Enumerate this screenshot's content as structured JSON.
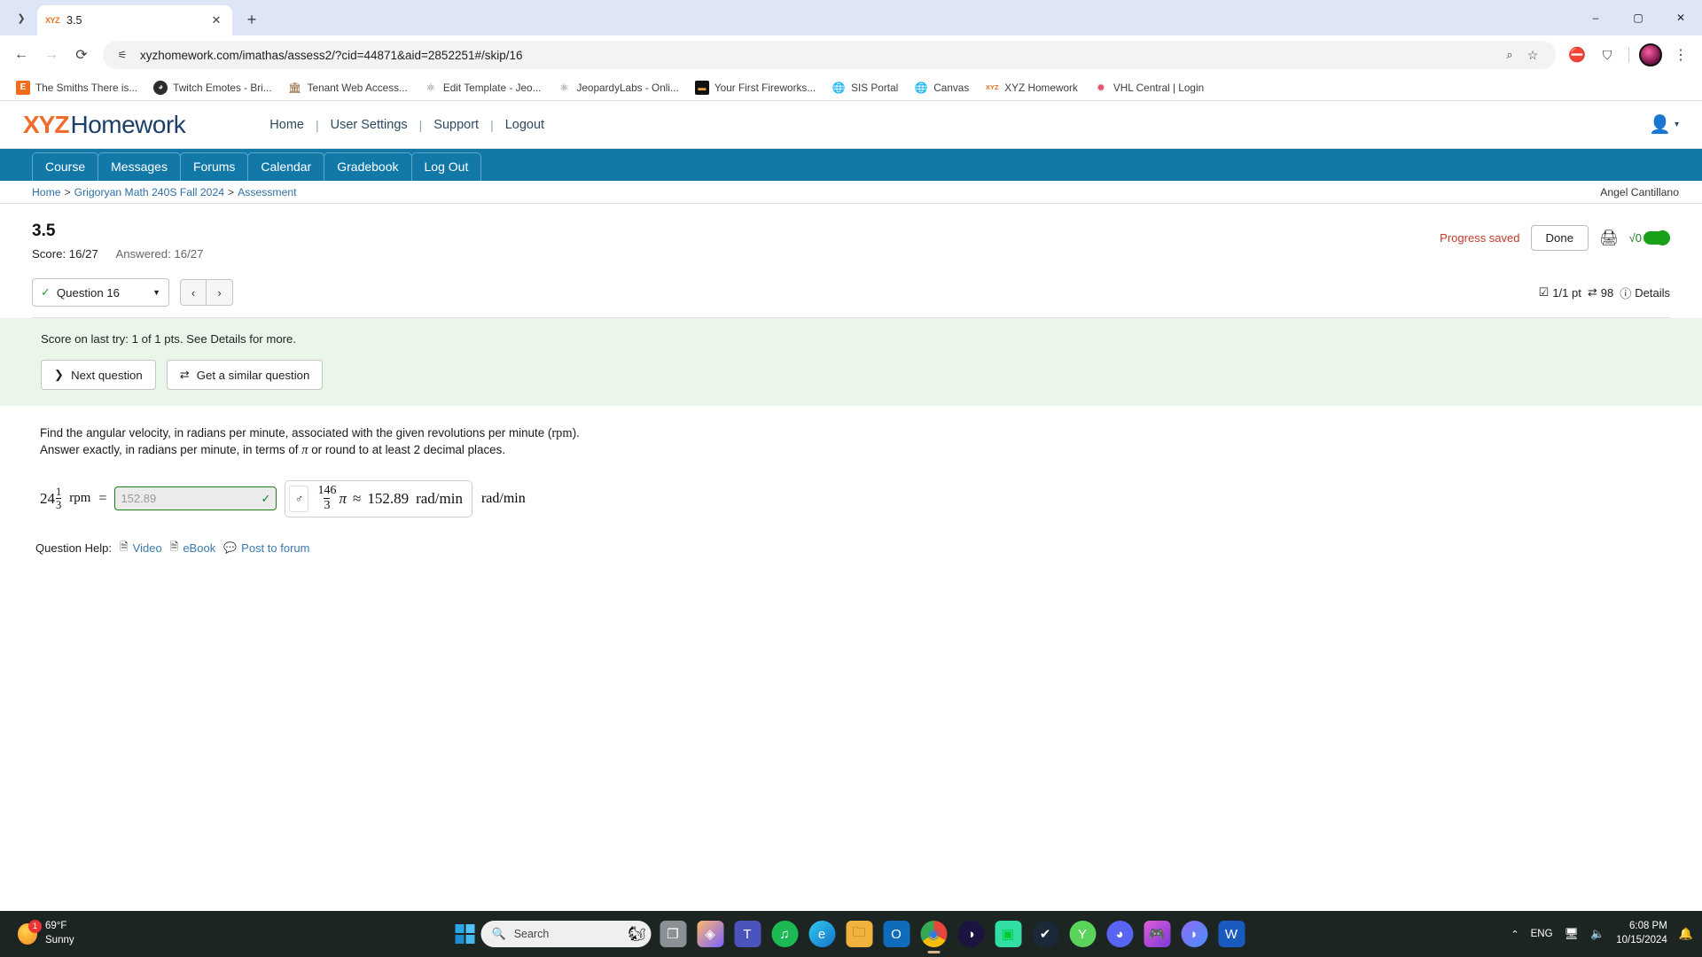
{
  "browser": {
    "tab": {
      "title": "3.5",
      "favicon": "XYZ",
      "close_icon": "close-icon"
    },
    "new_tab_label": "+",
    "window_controls": {
      "minimize": "–",
      "maximize": "▢",
      "close": "✕"
    },
    "nav": {
      "back": "←",
      "forward": "→",
      "reload": "⟳"
    },
    "omnibox": {
      "url": "xyzhomework.com/imathas/assess2/?cid=44871&aid=2852251#/skip/16",
      "site_settings_icon": "site-settings-icon",
      "zoom_icon": "zoom-out-icon",
      "bookmark_icon": "star-icon"
    },
    "extensions": {
      "adblock": "adblock-icon",
      "puzzle": "extensions-icon",
      "profile": "profile-avatar",
      "menu": "⋮"
    },
    "bookmarks": [
      {
        "label": "The Smiths There is...",
        "icon": "E",
        "icon_type": "letter-orange"
      },
      {
        "label": "Twitch Emotes - Bri...",
        "icon": "◕",
        "icon_type": "face"
      },
      {
        "label": "Tenant Web Access...",
        "icon": "🏛",
        "icon_type": "building"
      },
      {
        "label": "Edit Template - Jeo...",
        "icon": "⚛",
        "icon_type": "atom"
      },
      {
        "label": "JeopardyLabs - Onli...",
        "icon": "⚛",
        "icon_type": "atom"
      },
      {
        "label": "Your First Fireworks...",
        "icon": "▬",
        "icon_type": "black"
      },
      {
        "label": "SIS Portal",
        "icon": "🌐",
        "icon_type": "globe"
      },
      {
        "label": "Canvas",
        "icon": "🌐",
        "icon_type": "globe"
      },
      {
        "label": "XYZ Homework",
        "icon": "XYZ",
        "icon_type": "xyz"
      },
      {
        "label": "VHL Central | Login",
        "icon": "✹",
        "icon_type": "vhl"
      }
    ]
  },
  "site": {
    "logo": {
      "xyz": "XYZ",
      "homework": "Homework"
    },
    "header_links": [
      "Home",
      "User Settings",
      "Support",
      "Logout"
    ],
    "header_separator": "|",
    "user_icon": "user-avatar-icon",
    "user_caret": "▾",
    "nav_tabs": [
      "Course",
      "Messages",
      "Forums",
      "Calendar",
      "Gradebook",
      "Log Out"
    ],
    "breadcrumb": {
      "items": [
        "Home",
        "Grigoryan Math 240S Fall 2024",
        "Assessment"
      ],
      "separator": ">"
    },
    "user_name": "Angel Cantillano"
  },
  "assessment": {
    "title": "3.5",
    "score_label": "Score: 16/27",
    "answered_label": "Answered: 16/27",
    "progress_saved": "Progress saved",
    "done_button": "Done",
    "print_icon": "print-icon",
    "math_toggle": {
      "symbol": "√0",
      "state": "on",
      "color": "#1aa11a"
    }
  },
  "question_nav": {
    "selected": "Question 16",
    "check_icon": "check-icon",
    "caret_icon": "chevron-down-icon",
    "prev_icon": "‹",
    "next_icon": "›",
    "points": "1/1 pt",
    "points_icon": "checkbox-icon",
    "attempts": "98",
    "attempts_icon": "retry-icon",
    "details_label": "Details",
    "details_icon": "info-icon"
  },
  "result": {
    "message": "Score on last try: 1 of 1 pts. See Details for more.",
    "next_question_button": "Next question",
    "next_question_icon": "chevron-right-icon",
    "similar_question_button": "Get a similar question",
    "similar_question_icon": "retry-icon",
    "background_color": "#eaf6ea"
  },
  "question": {
    "prompt_part1": "Find the angular velocity, in radians per minute, associated with the given revolutions per minute (",
    "prompt_rpm": "rpm",
    "prompt_part2": "). Answer exactly, in radians per minute, in terms of ",
    "prompt_pi": "π",
    "prompt_part3": " or round to at least 2 decimal places.",
    "given": {
      "whole": "24",
      "numerator": "1",
      "denominator": "3",
      "unit": "rpm"
    },
    "equals": "=",
    "answer_field": {
      "value": "152.89",
      "status": "correct",
      "tick_icon": "check-icon"
    },
    "preview": {
      "mars_icon": "mars-symbol-icon",
      "numerator": "146",
      "denominator": "3",
      "pi": "π",
      "approx": "≈",
      "approx_value": "152.89",
      "approx_unit": "rad/min"
    },
    "trailing_unit": "rad/min"
  },
  "question_help": {
    "label": "Question Help:",
    "links": [
      {
        "label": "Video",
        "icon": "document-icon"
      },
      {
        "label": "eBook",
        "icon": "document-icon"
      },
      {
        "label": "Post to forum",
        "icon": "comment-icon"
      }
    ]
  },
  "taskbar": {
    "weather": {
      "temp": "69°F",
      "condition": "Sunny",
      "badge": "1",
      "icon": "sun-icon"
    },
    "start_icon": "windows-start-icon",
    "search": {
      "placeholder": "Search",
      "icon": "search-icon",
      "decoration": "squirrel-icon"
    },
    "apps": [
      {
        "name": "task-view-icon",
        "glyph": "❐",
        "color": "#9aa0a6"
      },
      {
        "name": "copilot-icon",
        "glyph": "◈",
        "color": "#7b61ff"
      },
      {
        "name": "teams-icon",
        "glyph": "T",
        "color": "#5059c9"
      },
      {
        "name": "spotify-icon",
        "glyph": "♫",
        "color": "#1db954"
      },
      {
        "name": "edge-icon",
        "glyph": "e",
        "color": "#0e8ecf"
      },
      {
        "name": "file-explorer-icon",
        "glyph": "🗀",
        "color": "#f2b33d"
      },
      {
        "name": "outlook-icon",
        "glyph": "O",
        "color": "#0f6cbd"
      },
      {
        "name": "chrome-icon",
        "glyph": "◉",
        "color": "#e8453c",
        "active": true
      },
      {
        "name": "audio-app-icon",
        "glyph": "◑",
        "color": "#1b1340"
      },
      {
        "name": "streamlabs-icon",
        "glyph": "▣",
        "color": "#31dfa4"
      },
      {
        "name": "steam-icon",
        "glyph": "✔",
        "color": "#1b2838"
      },
      {
        "name": "yuzu-icon",
        "glyph": "Y",
        "color": "#5ad35a"
      },
      {
        "name": "discord-icon",
        "glyph": "◕",
        "color": "#5865f2"
      },
      {
        "name": "xbox-app-icon",
        "glyph": "🎮",
        "color": "#b14bd8"
      },
      {
        "name": "powertoys-icon",
        "glyph": "◗",
        "color": "#7a5af5"
      },
      {
        "name": "word-icon",
        "glyph": "W",
        "color": "#185abd"
      }
    ],
    "tray": {
      "chevron": "⌃",
      "language": "ENG",
      "network_icon": "network-icon",
      "volume_icon": "volume-icon",
      "time": "6:08 PM",
      "date": "10/15/2024",
      "notification_icon": "bell-icon"
    }
  }
}
